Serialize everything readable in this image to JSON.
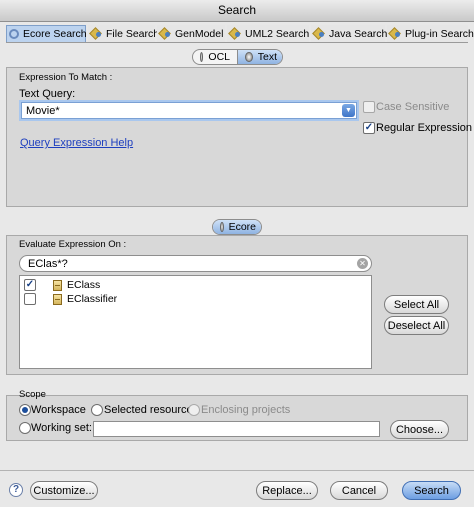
{
  "window": {
    "title": "Search"
  },
  "tabs": [
    {
      "label": "Ecore Search",
      "icon": "search-icon",
      "active": true
    },
    {
      "label": "File Search",
      "icon": "file-search-icon",
      "active": false
    },
    {
      "label": "GenModel",
      "icon": "genmodel-icon",
      "active": false
    },
    {
      "label": "UML2 Search",
      "icon": "uml2-icon",
      "active": false
    },
    {
      "label": "Java Search",
      "icon": "java-icon",
      "active": false
    },
    {
      "label": "Plug-in Search",
      "icon": "plugin-icon",
      "active": false
    }
  ],
  "mode_toggle": {
    "ocl_label": "OCL",
    "text_label": "Text",
    "selected": "Text"
  },
  "expression": {
    "group_label": "Expression To Match :",
    "query_label": "Text Query:",
    "query_value": "Movie*",
    "case_sensitive_label": "Case Sensitive",
    "case_sensitive_checked": false,
    "regex_label": "Regular Expression",
    "regex_checked": true,
    "help_link": "Query Expression Help"
  },
  "evaluate": {
    "scope_toggle_label": "Ecore",
    "group_label": "Evaluate Expression On :",
    "filter_value": "EClas*?",
    "items": [
      {
        "label": "EClass",
        "checked": true
      },
      {
        "label": "EClassifier",
        "checked": false
      }
    ],
    "select_all_label": "Select All",
    "deselect_all_label": "Deselect All"
  },
  "scope": {
    "group_label": "Scope",
    "workspace_label": "Workspace",
    "selected_resources_label": "Selected resources",
    "enclosing_projects_label": "Enclosing projects",
    "working_set_label": "Working set:",
    "working_set_value": "",
    "choose_label": "Choose...",
    "selected": "Workspace"
  },
  "footer": {
    "help_symbol": "?",
    "customize_label": "Customize...",
    "replace_label": "Replace...",
    "cancel_label": "Cancel",
    "search_label": "Search"
  },
  "colors": {
    "accent": "#6d9ee2",
    "link": "#1e3fbf",
    "tab_active": "#bcd3ef"
  }
}
